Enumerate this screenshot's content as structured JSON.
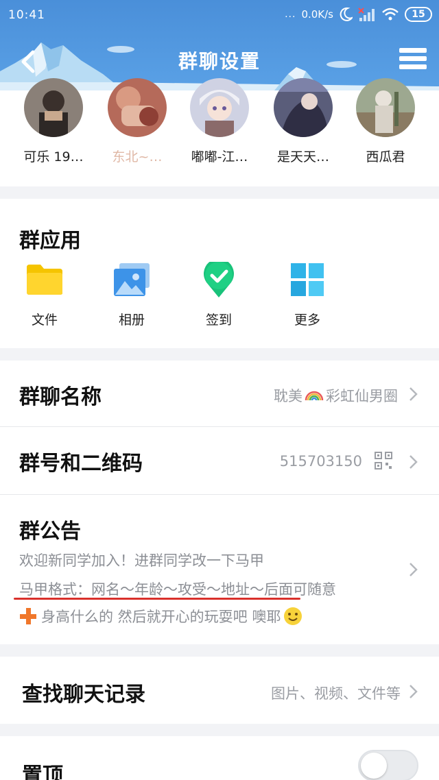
{
  "status_bar": {
    "time": "10:41",
    "dots": "...",
    "net_speed": "0.0K/s",
    "battery": "15"
  },
  "nav": {
    "title": "群聊设置"
  },
  "members": [
    {
      "name": "可乐 19…"
    },
    {
      "name": "东北~…"
    },
    {
      "name": "嘟嘟-江…"
    },
    {
      "name": "是天天…"
    },
    {
      "name": "西瓜君"
    }
  ],
  "group_apps": {
    "title": "群应用",
    "items": [
      {
        "label": "文件",
        "icon": "folder-icon"
      },
      {
        "label": "相册",
        "icon": "album-icon"
      },
      {
        "label": "签到",
        "icon": "checkin-icon"
      },
      {
        "label": "更多",
        "icon": "more-grid-icon"
      }
    ]
  },
  "group_name": {
    "title": "群聊名称",
    "value_prefix": "耽美",
    "value_suffix": "彩虹仙男圈"
  },
  "group_number": {
    "title": "群号和二维码",
    "value": "515703150"
  },
  "announcement": {
    "title": "群公告",
    "line1": "欢迎新同学加入！进群同学改一下马甲",
    "line2": "马甲格式：网名～年龄～攻受～地址～后面可随意",
    "line3": "身高什么的 然后就开心的玩耍吧 噢耶"
  },
  "search_history": {
    "title": "查找聊天记录",
    "value": "图片、视频、文件等"
  },
  "pin_top": {
    "title": "置顶",
    "enabled": false
  },
  "colors": {
    "header_blue": "#4a8fd9",
    "announcement_underline": "#d9302b"
  }
}
